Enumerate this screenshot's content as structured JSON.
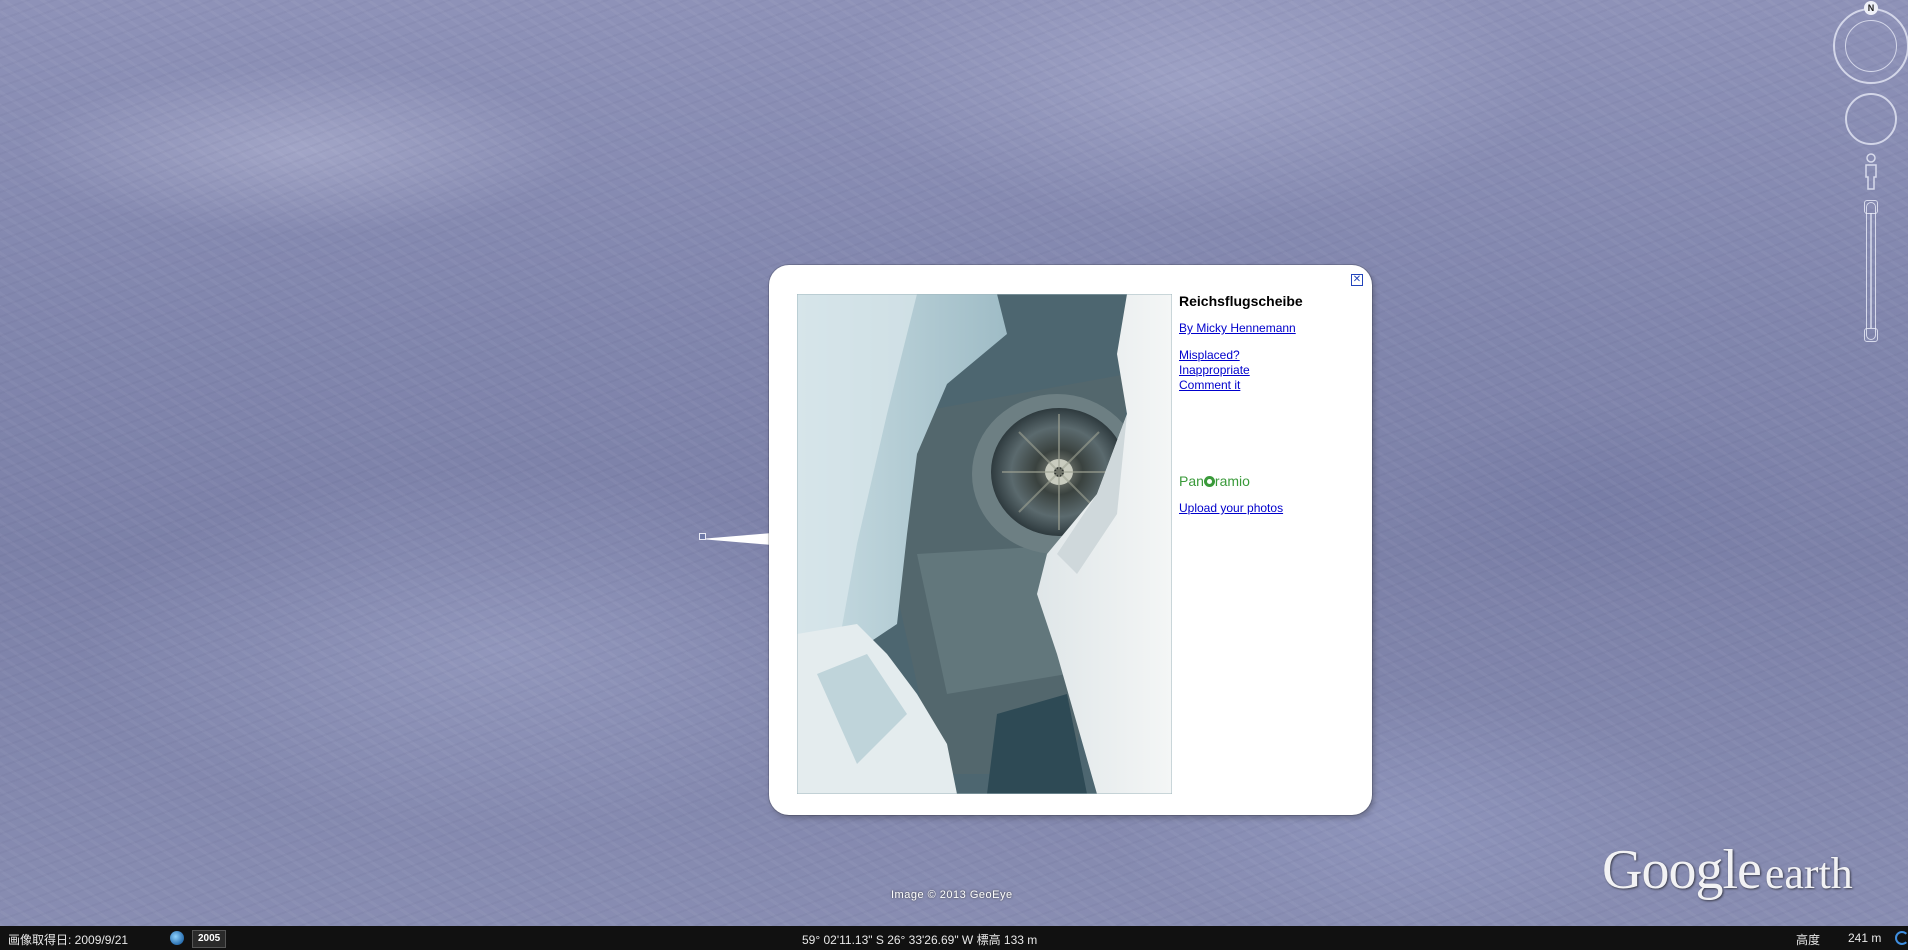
{
  "balloon": {
    "title": "Reichsflugscheibe",
    "author_link": "By Micky Hennemann",
    "misplaced_link": "Misplaced?",
    "inappropriate_link": "Inappropriate",
    "comment_link": "Comment it",
    "logo_text_before": "Pan",
    "logo_text_after": "ramio",
    "upload_link": "Upload your photos",
    "close_label": "✕"
  },
  "map": {
    "credit": "Image © 2013 GeoEye",
    "logo_google": "Google",
    "logo_earth": "earth"
  },
  "navigation": {
    "north_label": "N"
  },
  "statusbar": {
    "imagery_date": "画像取得日: 2009/9/21",
    "historical_year": "2005",
    "coordinates": "59° 02'11.13\" S  26° 33'26.69\" W  標高   133 m",
    "altitude_label": "高度",
    "altitude_value": "241 m"
  },
  "colors": {
    "link": "#0000cc",
    "panoramio_green": "#3a9a3a",
    "statusbar_bg": "#111111"
  }
}
